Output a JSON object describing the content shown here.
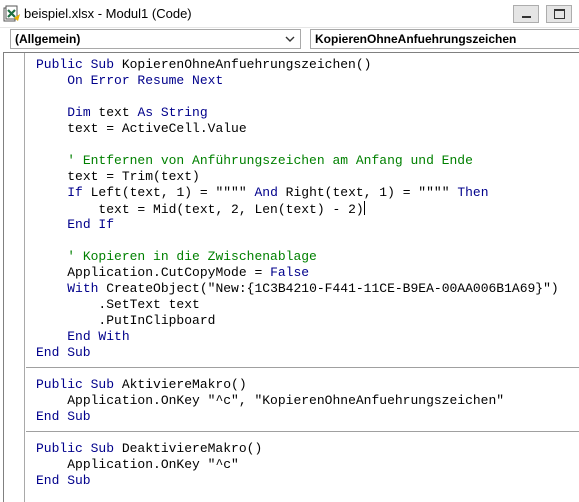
{
  "window": {
    "title": "beispiel.xlsx - Modul1 (Code)",
    "icon": "excel-vba-module-icon"
  },
  "combos": {
    "object": "(Allgemein)",
    "procedure": "KopierenOhneAnfuehrungszeichen"
  },
  "colors": {
    "keyword": "#00008b",
    "comment": "#008000",
    "text": "#000000",
    "separator": "#a0a0a0"
  },
  "code": {
    "l01a": "Public Sub",
    "l01b": " KopierenOhneAnfuehrungszeichen()",
    "l02a": "On Error Resume Next",
    "l04a": "Dim",
    "l04b": " text ",
    "l04c": "As String",
    "l05a": "text = ActiveCell.Value",
    "l07a": "' Entfernen von Anführungszeichen am Anfang und Ende",
    "l08a": "text = Trim(text)",
    "l09a": "If",
    "l09b": " Left(text, 1) = \"\"\"\" ",
    "l09c": "And",
    "l09d": " Right(text, 1) = \"\"\"\" ",
    "l09e": "Then",
    "l10a": "text = Mid(text, 2, Len(text) - 2)",
    "l11a": "End If",
    "l13a": "' Kopieren in die Zwischenablage",
    "l14a": "Application.CutCopyMode = ",
    "l14b": "False",
    "l15a": "With",
    "l15b": " CreateObject(\"New:{1C3B4210-F441-11CE-B9EA-00AA006B1A69}\")",
    "l16a": ".SetText text",
    "l17a": ".PutInClipboard",
    "l18a": "End With",
    "l19a": "End Sub",
    "l21a": "Public Sub",
    "l21b": " AktiviereMakro()",
    "l22a": "Application.OnKey \"^c\", \"KopierenOhneAnfuehrungszeichen\"",
    "l23a": "End Sub",
    "l25a": "Public Sub",
    "l25b": " DeaktiviereMakro()",
    "l26a": "Application.OnKey \"^c\"",
    "l27a": "End Sub"
  }
}
